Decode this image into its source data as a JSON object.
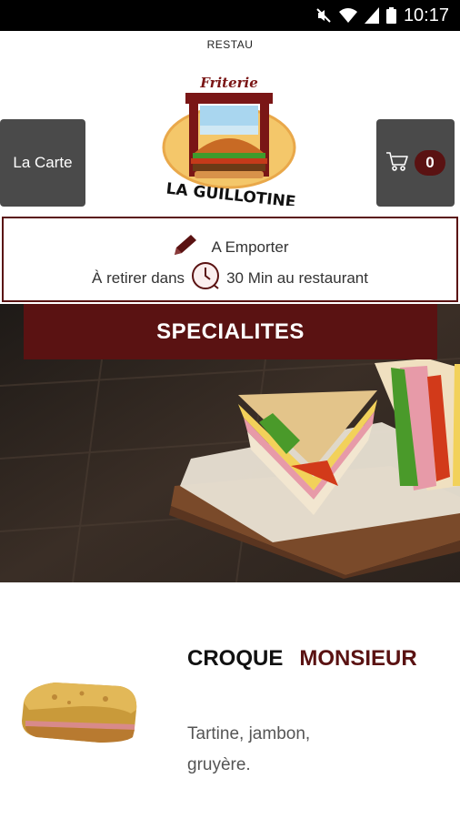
{
  "status_bar": {
    "time": "10:17",
    "icons": [
      "mute-icon",
      "wifi-icon",
      "signal-icon",
      "battery-icon"
    ]
  },
  "header": {
    "restaurant_label": "RESTAU",
    "menu_button_label": "La Carte",
    "cart_count": "0",
    "logo": {
      "top_text": "Friterie",
      "bottom_text": "LA GUILLOTINE"
    }
  },
  "order_info": {
    "mode_label": "A Emporter",
    "pickup_prefix": "À retirer dans",
    "pickup_time": "30 Min au restaurant",
    "icons": [
      "pencil-icon",
      "clock-icon"
    ]
  },
  "category": {
    "name": "SPECIALITES"
  },
  "product": {
    "title_word1": "CROQUE",
    "title_word2": "MONSIEUR",
    "description": "Tartine, jambon, gruyère."
  },
  "colors": {
    "brand": "#5a1212",
    "button_grey": "#4a4a4a",
    "status_bar": "#000000"
  }
}
